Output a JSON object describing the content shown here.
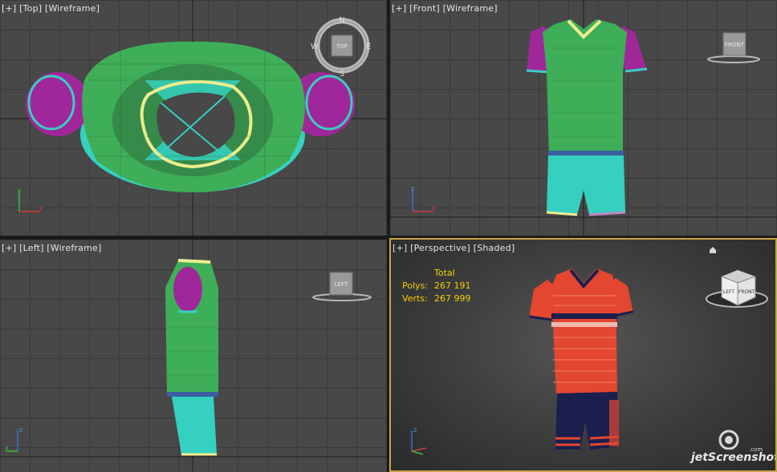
{
  "viewports": {
    "top": {
      "plus": "[+]",
      "view": "[Top]",
      "mode": "[Wireframe]"
    },
    "front": {
      "plus": "[+]",
      "view": "[Front]",
      "mode": "[Wireframe]"
    },
    "left": {
      "plus": "[+]",
      "view": "[Left]",
      "mode": "[Wireframe]"
    },
    "perspective": {
      "plus": "[+]",
      "view": "[Perspective]",
      "mode": "[Shaded]"
    }
  },
  "viewcube": {
    "top_face": "TOP",
    "front_face": "FRONT",
    "left_face": "LEFT",
    "persp_front": "FRONT",
    "persp_left": "LEFT",
    "compass": {
      "n": "N",
      "s": "S",
      "e": "E",
      "w": "W"
    }
  },
  "stats": {
    "header": "Total",
    "polys_label": "Polys:",
    "polys_value": "267 191",
    "verts_label": "Verts:",
    "verts_value": "267 999"
  },
  "axes": {
    "x": "x",
    "y": "y",
    "z": "z"
  },
  "watermark": {
    "text": "jetScreenshot",
    "sub": ".com"
  },
  "colors": {
    "grid_bg": "#484848",
    "active_border": "#c8a445",
    "wire_green": "#3fae58",
    "wire_cyan": "#35d0c0",
    "wire_magenta": "#a0279a",
    "wire_yellow": "#ecec8e",
    "stats_yellow": "#f2d000",
    "jersey_red": "#e4472f",
    "shorts_navy": "#1b1f4e"
  }
}
